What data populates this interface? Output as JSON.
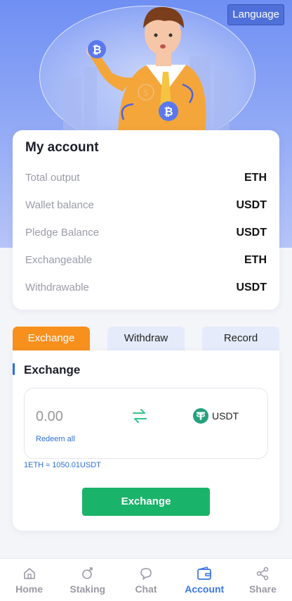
{
  "header": {
    "language_label": "Language"
  },
  "account": {
    "title": "My account",
    "rows": [
      {
        "label": "Total output",
        "value": "ETH"
      },
      {
        "label": "Wallet balance",
        "value": "USDT"
      },
      {
        "label": "Pledge Balance",
        "value": "USDT"
      },
      {
        "label": "Exchangeable",
        "value": "ETH"
      },
      {
        "label": "Withdrawable",
        "value": "USDT"
      }
    ]
  },
  "tabs": [
    {
      "label": "Exchange",
      "active": true
    },
    {
      "label": "Withdraw",
      "active": false
    },
    {
      "label": "Record",
      "active": false
    }
  ],
  "exchange": {
    "title": "Exchange",
    "amount": "0.00",
    "redeem_label": "Redeem all",
    "coin": "USDT",
    "rate": "1ETH ≈ 1050.01USDT",
    "button_label": "Exchange"
  },
  "nav": [
    {
      "label": "Home",
      "icon": "home-icon",
      "active": false
    },
    {
      "label": "Staking",
      "icon": "staking-icon",
      "active": false
    },
    {
      "label": "Chat",
      "icon": "chat-icon",
      "active": false
    },
    {
      "label": "Account",
      "icon": "wallet-icon",
      "active": true
    },
    {
      "label": "Share",
      "icon": "share-icon",
      "active": false
    }
  ],
  "colors": {
    "accent_orange": "#f8901e",
    "accent_blue": "#3a74e8",
    "button_green": "#1ab36a",
    "tether_green": "#26a17b"
  }
}
